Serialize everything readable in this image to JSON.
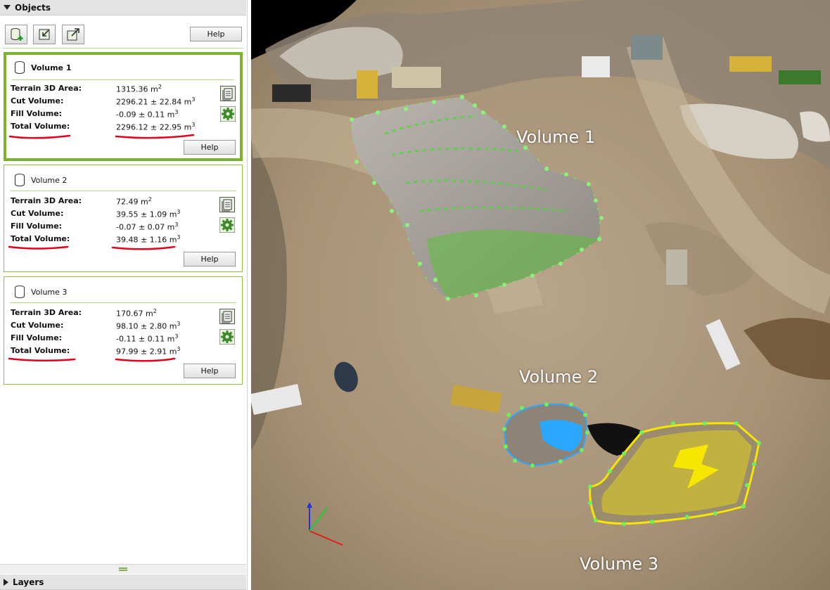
{
  "panel": {
    "objects_header": "Objects",
    "layers_header": "Layers",
    "toolbar": {
      "new_volume_icon": "new-volume-icon",
      "import_icon": "import-icon",
      "export_icon": "export-icon",
      "help_label": "Help"
    },
    "volumes": [
      {
        "name": "Volume 1",
        "terrain_label": "Terrain 3D Area:",
        "terrain_value": "1315.36  m",
        "cut_label": "Cut Volume:",
        "cut_value": "2296.21 ± 22.84  m",
        "fill_label": "Fill Volume:",
        "fill_value": "-0.09 ± 0.11  m",
        "total_label": "Total Volume:",
        "total_value": "2296.12 ± 22.95  m",
        "help_label": "Help"
      },
      {
        "name": "Volume 2",
        "terrain_label": "Terrain 3D Area:",
        "terrain_value": "72.49  m",
        "cut_label": "Cut Volume:",
        "cut_value": "39.55 ± 1.09  m",
        "fill_label": "Fill Volume:",
        "fill_value": "-0.07 ± 0.07  m",
        "total_label": "Total Volume:",
        "total_value": "39.48 ± 1.16  m",
        "help_label": "Help"
      },
      {
        "name": "Volume 3",
        "terrain_label": "Terrain 3D Area:",
        "terrain_value": "170.67  m",
        "cut_label": "Cut Volume:",
        "cut_value": "98.10 ± 2.80  m",
        "fill_label": "Fill Volume:",
        "fill_value": "-0.11 ± 0.11  m",
        "total_label": "Total Volume:",
        "total_value": "97.99 ± 2.91  m",
        "help_label": "Help"
      }
    ],
    "units": {
      "area_exp": "2",
      "volume_exp": "3"
    }
  },
  "view": {
    "labels": [
      "Volume 1",
      "Volume 2",
      "Volume 3"
    ]
  },
  "colors": {
    "accent_green": "#8cc63f",
    "selected_green": "#79b42c",
    "underline_red": "#e0001b",
    "volume1_outline": "#7be36b",
    "volume2_outline": "#2aa7ff",
    "volume3_outline": "#f6e600"
  }
}
